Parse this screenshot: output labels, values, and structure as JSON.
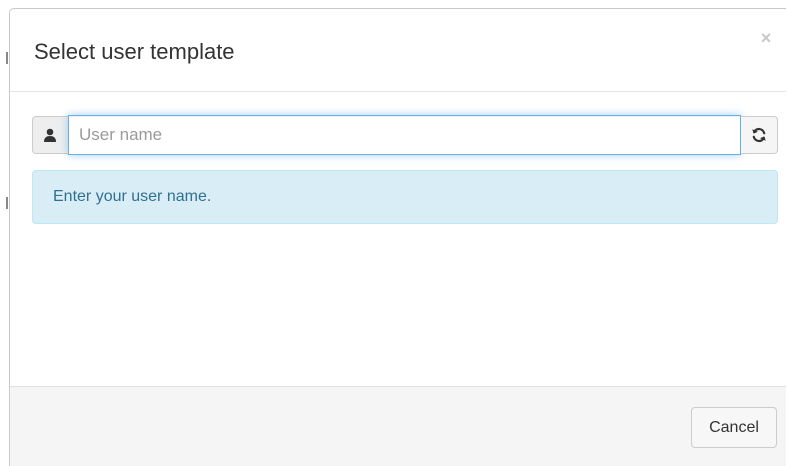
{
  "dialog": {
    "title": "Select user template",
    "close_symbol": "×"
  },
  "form": {
    "username_placeholder": "User name",
    "username_value": "",
    "left_addon_icon": "user-icon",
    "right_addon_icon": "refresh-icon"
  },
  "alert": {
    "message": "Enter your user name."
  },
  "footer": {
    "cancel_label": "Cancel"
  },
  "colors": {
    "alert_bg": "#d9edf7",
    "alert_text": "#31708f",
    "input_focus_border": "#66afe9",
    "footer_bg": "#f5f5f5"
  }
}
